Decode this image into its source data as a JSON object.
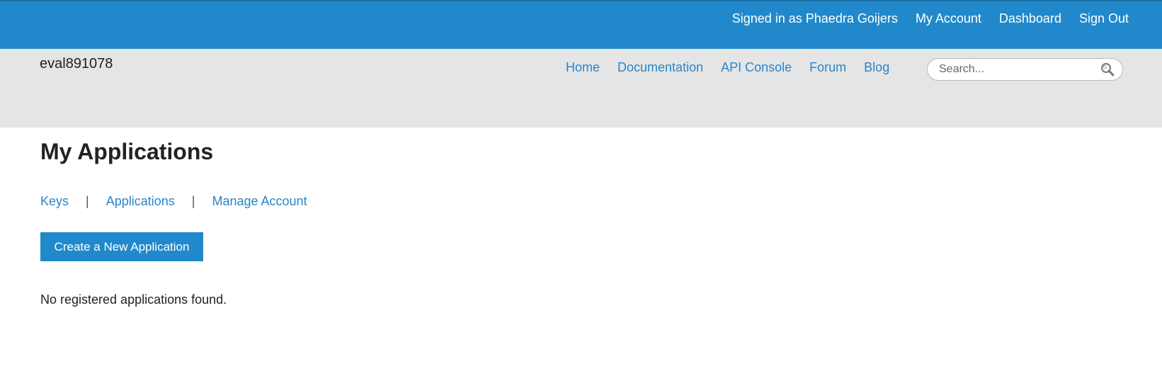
{
  "topbar": {
    "signed_in_text": "Signed in as Phaedra Goijers",
    "links": [
      "My Account",
      "Dashboard",
      "Sign Out"
    ]
  },
  "header": {
    "site_name": "eval891078",
    "nav": [
      "Home",
      "Documentation",
      "API Console",
      "Forum",
      "Blog"
    ],
    "search": {
      "placeholder": "Search...",
      "value": "",
      "icon": "search-icon"
    }
  },
  "main": {
    "title": "My Applications",
    "subnav": [
      "Keys",
      "Applications",
      "Manage Account"
    ],
    "separator": "|",
    "create_button": "Create a New Application",
    "empty_message": "No registered applications found."
  },
  "colors": {
    "topbar": "#2189cb",
    "header": "#e5e5e6",
    "link": "#2a86c8",
    "button": "#2189cb"
  }
}
